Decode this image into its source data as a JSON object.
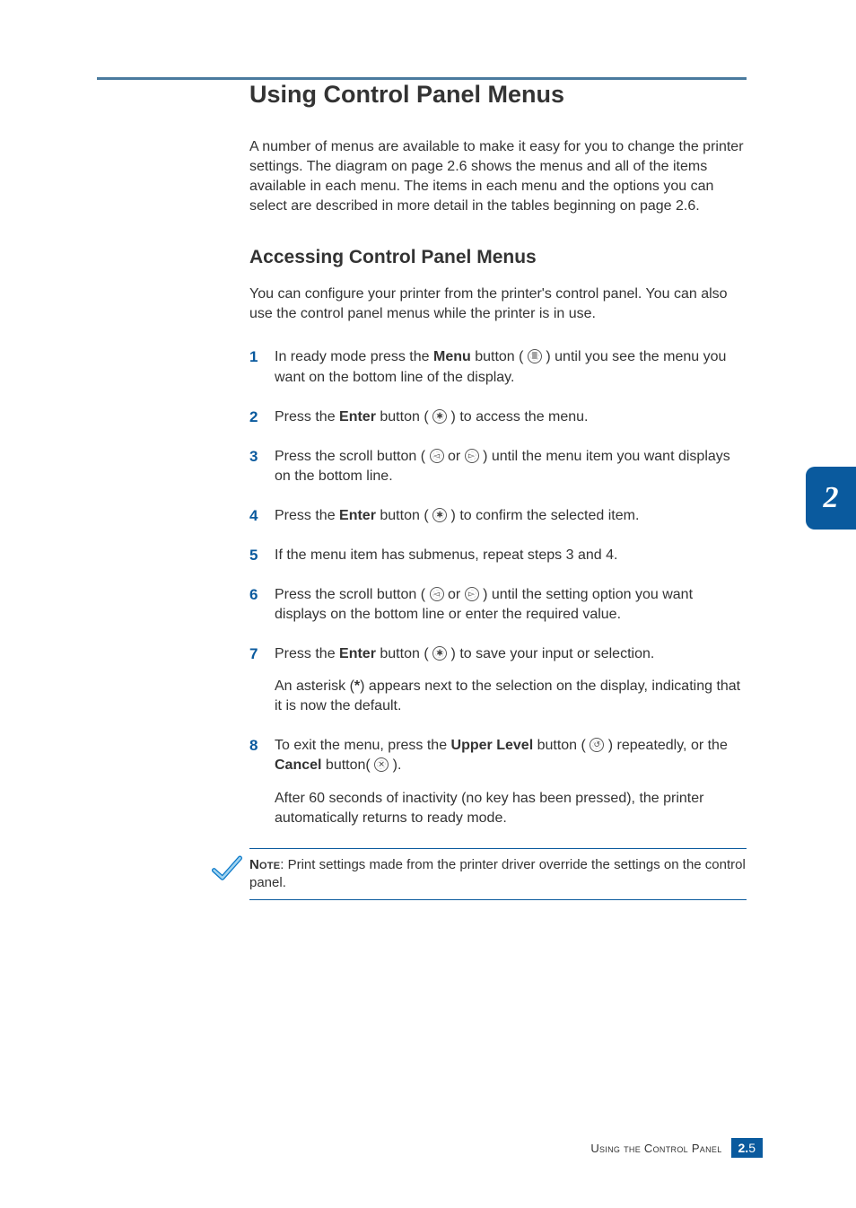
{
  "title": "Using Control Panel Menus",
  "intro": "A number of menus are available to make it easy for you to change the printer settings. The diagram on page 2.6 shows the menus and all of the items available in each menu. The items in each menu and the options you can select are described in more detail in the tables beginning on page 2.6.",
  "subheading": "Accessing Control Panel Menus",
  "sub_intro": "You can configure your printer from the printer's control panel. You can also use the control panel menus while the printer is in use.",
  "steps": {
    "s1a": "In ready mode press the ",
    "s1_menu": "Menu",
    "s1b": " button ( ",
    "s1c": " ) until you see the menu you want on the bottom line of the display.",
    "s2a": "Press the ",
    "s2_enter": "Enter",
    "s2b": " button ( ",
    "s2c": " ) to access the menu.",
    "s3a": "Press the scroll button ( ",
    "s3b": " or ",
    "s3c": " ) until the menu item you want displays on the bottom line.",
    "s4a": "Press the ",
    "s4_enter": "Enter",
    "s4b": " button ( ",
    "s4c": " ) to confirm the selected item.",
    "s5": "If the menu item has submenus, repeat steps 3 and 4.",
    "s6a": "Press the scroll button ( ",
    "s6b": " or ",
    "s6c": " ) until the setting option you want displays on the bottom line or enter the required value.",
    "s7a": "Press the ",
    "s7_enter": "Enter",
    "s7b": " button ( ",
    "s7c": " ) to save your input or selection.",
    "s7_after_a": "An asterisk (",
    "s7_asterisk": "*",
    "s7_after_b": ") appears next to the selection on the display, indicating that it is now the default.",
    "s8a": "To exit the menu, press the ",
    "s8_upper": "Upper Level",
    "s8b": " button ( ",
    "s8c": " ) repeatedly, or the ",
    "s8_cancel": "Cancel",
    "s8d": " button( ",
    "s8e": " ).",
    "s8_after": "After 60 seconds of inactivity (no key has been pressed), the printer automatically returns to ready mode."
  },
  "nums": {
    "n1": "1",
    "n2": "2",
    "n3": "3",
    "n4": "4",
    "n5": "5",
    "n6": "6",
    "n7": "7",
    "n8": "8"
  },
  "icons": {
    "menu": "≣",
    "enter": "✱",
    "left": "◅",
    "right": "▻",
    "up": "↺",
    "cancel": "✕"
  },
  "note_label": "Note",
  "note_text": ": Print settings made from the printer driver override the settings on the control panel.",
  "tab": "2",
  "footer_label": "Using the Control Panel",
  "footer_chapter": "2.",
  "footer_page": "5"
}
